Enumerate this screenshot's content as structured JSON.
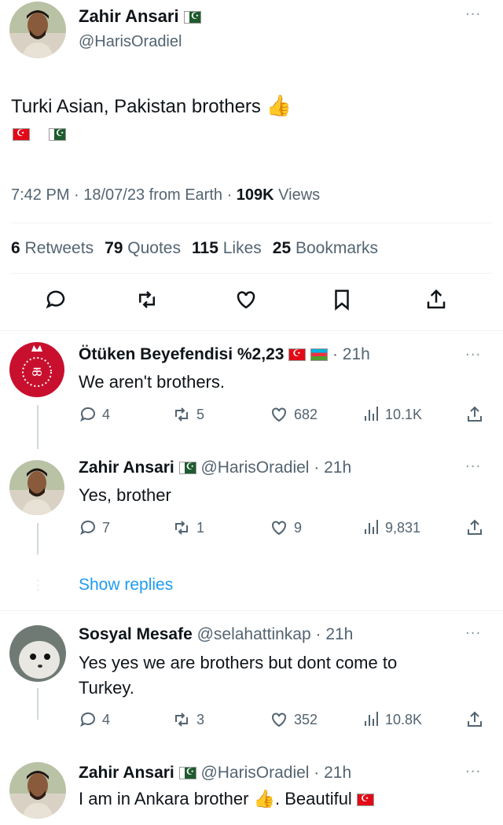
{
  "main_tweet": {
    "author_name": "Zahir Ansari",
    "handle": "@HarisOradiel",
    "text": "Turki Asian, Pakistan brothers",
    "time": "7:42 PM · 18/07/23 from Earth · ",
    "views_count": "109K",
    "views_label": " Views",
    "stats": [
      {
        "count": "6",
        "label": "Retweets"
      },
      {
        "count": "79",
        "label": "Quotes"
      },
      {
        "count": "115",
        "label": "Likes"
      },
      {
        "count": "25",
        "label": "Bookmarks"
      }
    ]
  },
  "replies": [
    {
      "author_name": "Ötüken Beyefendisi %2,23",
      "meta": "· 21h",
      "text": "We aren't brothers.",
      "replies": "4",
      "retweets": "5",
      "likes": "682",
      "views": "10.1K"
    },
    {
      "author_name": "Zahir Ansari",
      "meta": "@HarisOradiel · 21h",
      "text": "Yes, brother",
      "replies": "7",
      "retweets": "1",
      "likes": "9",
      "views": "9,831"
    },
    {
      "author_name": "Sosyal Mesafe",
      "meta": "@selahattinkap · 21h",
      "text_line1": "Yes yes we are brothers but dont come to",
      "text_line2": "Turkey.",
      "replies": "4",
      "retweets": "3",
      "likes": "352",
      "views": "10.8K"
    },
    {
      "author_name": "Zahir Ansari",
      "meta": "@HarisOradiel · 21h",
      "text_a": "I am in Ankara brother",
      "text_b": ". Beautiful"
    }
  ],
  "show_replies": "Show replies",
  "colors": {
    "accent": "#1d9bf0",
    "muted": "#536471",
    "text": "#0f1419"
  },
  "icons": [
    "reply-icon",
    "retweet-icon",
    "like-icon",
    "bookmark-icon",
    "share-icon",
    "views-icon",
    "more-icon"
  ]
}
